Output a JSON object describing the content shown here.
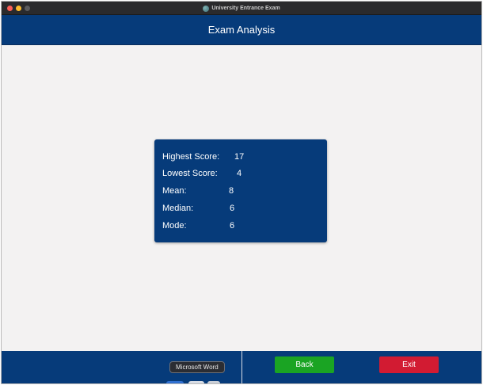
{
  "window": {
    "title": "University Entrance Exam"
  },
  "header": {
    "title": "Exam Analysis"
  },
  "stats": [
    {
      "label": "Highest Score:",
      "value": "17"
    },
    {
      "label": "Lowest Score:",
      "value": "4"
    },
    {
      "label": "Mean:",
      "value": "8"
    },
    {
      "label": "Median:",
      "value": "6"
    },
    {
      "label": "Mode:",
      "value": "6"
    }
  ],
  "footer": {
    "back_label": "Back",
    "exit_label": "Exit",
    "tooltip": "Microsoft Word"
  },
  "colors": {
    "primary": "#063b7a",
    "back_button": "#1aa423",
    "exit_button": "#d21b32",
    "background": "#f3f2f2"
  }
}
